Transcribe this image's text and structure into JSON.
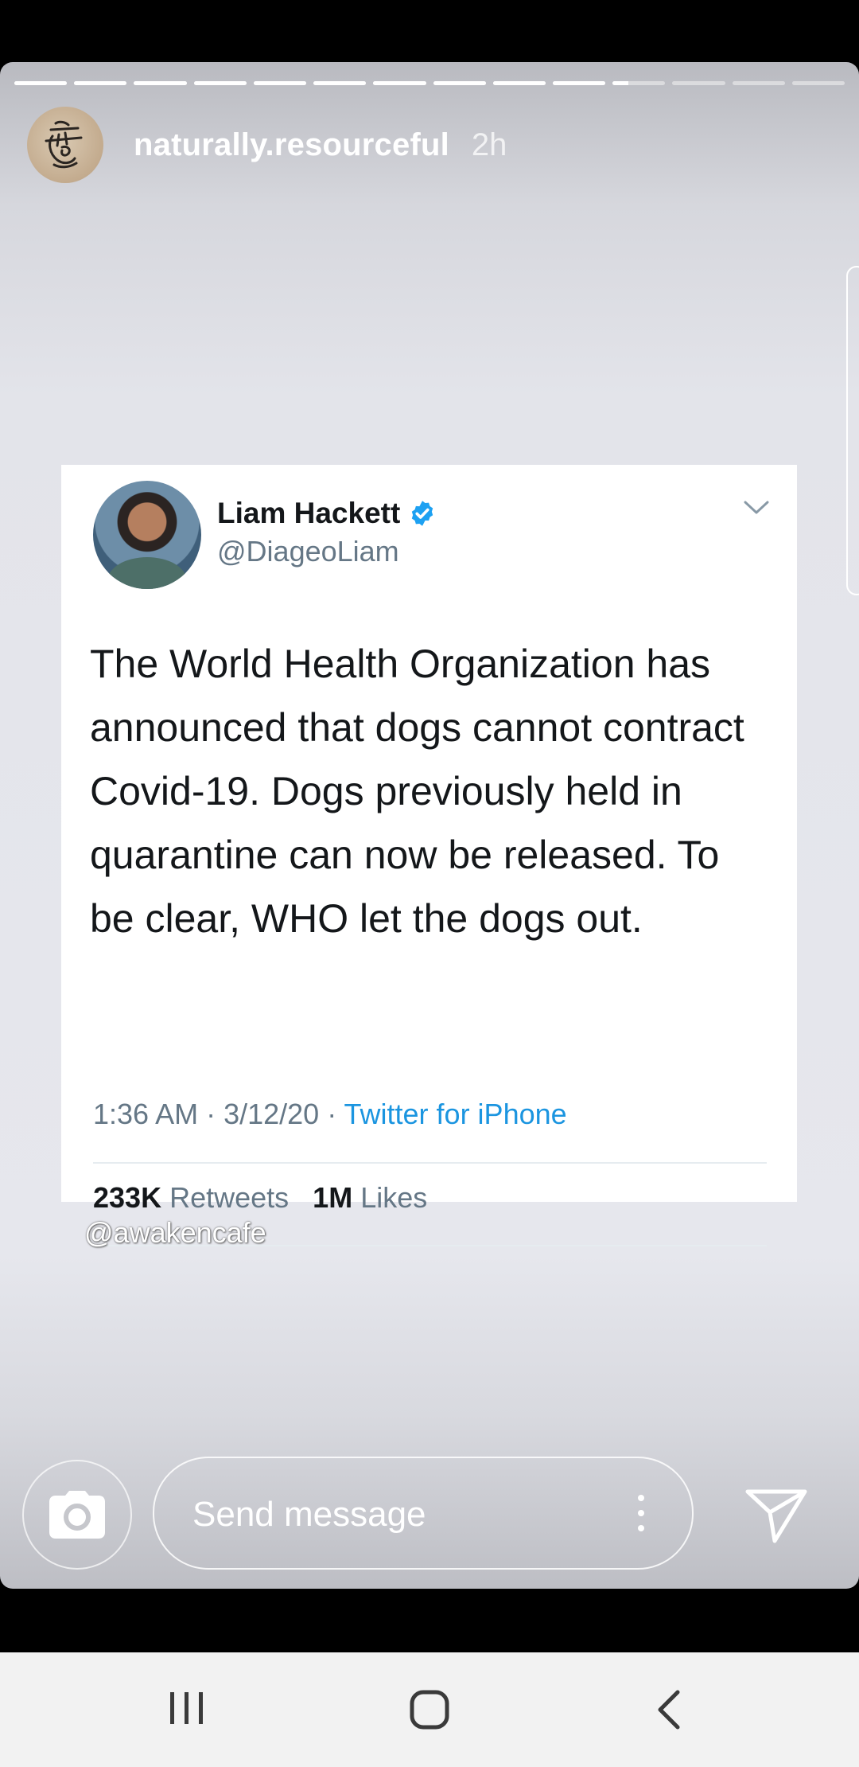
{
  "story": {
    "progress": {
      "total_segments": 14,
      "completed_segments": 10,
      "current_segment_fraction": 0.3
    },
    "username": "naturally.resourceful",
    "time_ago": "2h",
    "avatar_icon": "sketch-face-icon"
  },
  "tweet": {
    "name": "Liam Hackett",
    "handle": "@DiageoLiam",
    "verified": true,
    "text": "The World Health Organization has announced that dogs cannot contract Covid-19. Dogs previously held in quarantine can now be released. To be clear, WHO let the dogs out.",
    "timestamp": "1:36 AM · 3/12/20 · ",
    "source": "Twitter for iPhone",
    "retweets_count": "233K",
    "retweets_label": "Retweets",
    "likes_count": "1M",
    "likes_label": "Likes",
    "colors": {
      "verified": "#1da1f2",
      "link": "#1b95e0",
      "text": "#14171a",
      "muted": "#657786"
    }
  },
  "watermark": "@awakencafe",
  "reply_bar": {
    "placeholder": "Send message",
    "camera_icon": "camera-icon",
    "send_icon": "send-icon",
    "more_icon": "more-vertical-icon"
  },
  "navigation_bar": {
    "recent_icon": "recent-apps-icon",
    "home_icon": "home-icon",
    "back_icon": "back-icon"
  }
}
